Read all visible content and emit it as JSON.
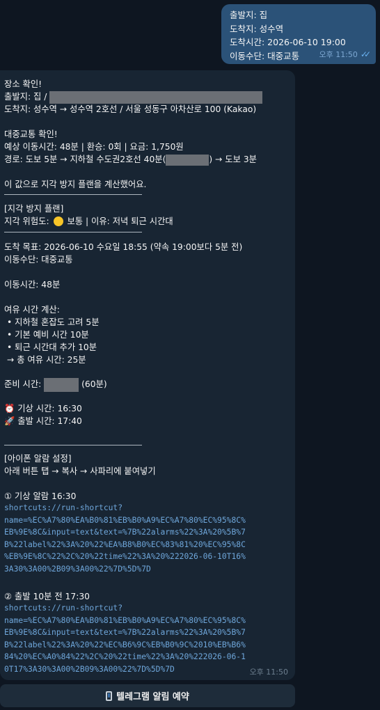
{
  "outgoing": {
    "lines": [
      "출발지: 집",
      "도착지: 성수역",
      "도착시간: 2026-06-10 19:00",
      "이동수단: 대중교통"
    ],
    "time": "오후 11:50"
  },
  "incoming": {
    "header": "장소 확인!",
    "origin_prefix": "출발지: 집 / ",
    "destination": "도착지: 성수역 → 성수역 2호선 / 서울 성동구 아차산로 100  (Kakao)",
    "transit_title": "대중교통 확인!",
    "transit_summary": "예상 이동시간: 48분  |  환승: 0회  |  요금: 1,750원",
    "route_prefix": "경로: 도보 5분 → 지하철 수도권2호선 40분(",
    "route_suffix": ") → 도보 3분",
    "calc_note": "이 값으로 지각 방지 플랜을 계산했어요.",
    "plan_title": "[지각 방지 플랜]",
    "risk_prefix": "지각 위험도: ",
    "risk_suffix": " 보통  |  이유: 저녁 퇴근 시간대",
    "arrival_goal": "도착 목표: 2026-06-10 수요일 18:55  (약속 19:00보다 5분 전)",
    "transport": "이동수단: 대중교통",
    "travel_time": "이동시간: 48분",
    "buffer_title": "여유 시간 계산:",
    "buffer_items": [
      "• 지하철 혼잡도 고려 5분",
      "• 기본 예비 시간 10분",
      "• 퇴근 시간대 추가 10분"
    ],
    "buffer_total": "→ 총 여유 시간: 25분",
    "prep_prefix": "준비 시간: ",
    "prep_suffix": " (60분)",
    "wake_time": "기상 시간: 16:30",
    "depart_time": "출발 시간: 17:40",
    "alarm_title": "[아이폰 알람 설정]",
    "alarm_instruction": "아래 버튼 탭 → 복사 → 사파리에 붙여넣기",
    "alarm1_label": "① 기상 알람  16:30",
    "alarm1_url": "shortcuts://run-shortcut?\nname=%EC%A7%80%EA%B0%81%EB%B0%A9%EC%A7%80%EC%95%8C%\nEB%9E%8C&input=text&text=%7B%22alarms%22%3A%20%5B%7\nB%22label%22%3A%20%22%EA%B8%B0%EC%83%81%20%EC%95%8C\n%EB%9E%8C%22%2C%20%22time%22%3A%20%222026-06-10T16%\n3A30%3A00%2B09%3A00%22%7D%5D%7D",
    "alarm2_label": "② 출발 10분 전  17:30",
    "alarm2_url": "shortcuts://run-shortcut?\nname=%EC%A7%80%EA%B0%81%EB%B0%A9%EC%A7%80%EC%95%8C%\nEB%9E%8C&input=text&text=%7B%22alarms%22%3A%20%5B%7\nB%22label%22%3A%20%22%EC%B6%9C%EB%B0%9C%2010%EB%B6%\n84%20%EC%A0%84%22%2C%20%22time%22%3A%20%222026-06-1\n0T17%3A30%3A00%2B09%3A00%22%7D%5D%7D",
    "time": "오후 11:50"
  },
  "keyboard_button": {
    "label": "텔레그램 알림 예약",
    "icon": "mobile-phone-icon"
  }
}
